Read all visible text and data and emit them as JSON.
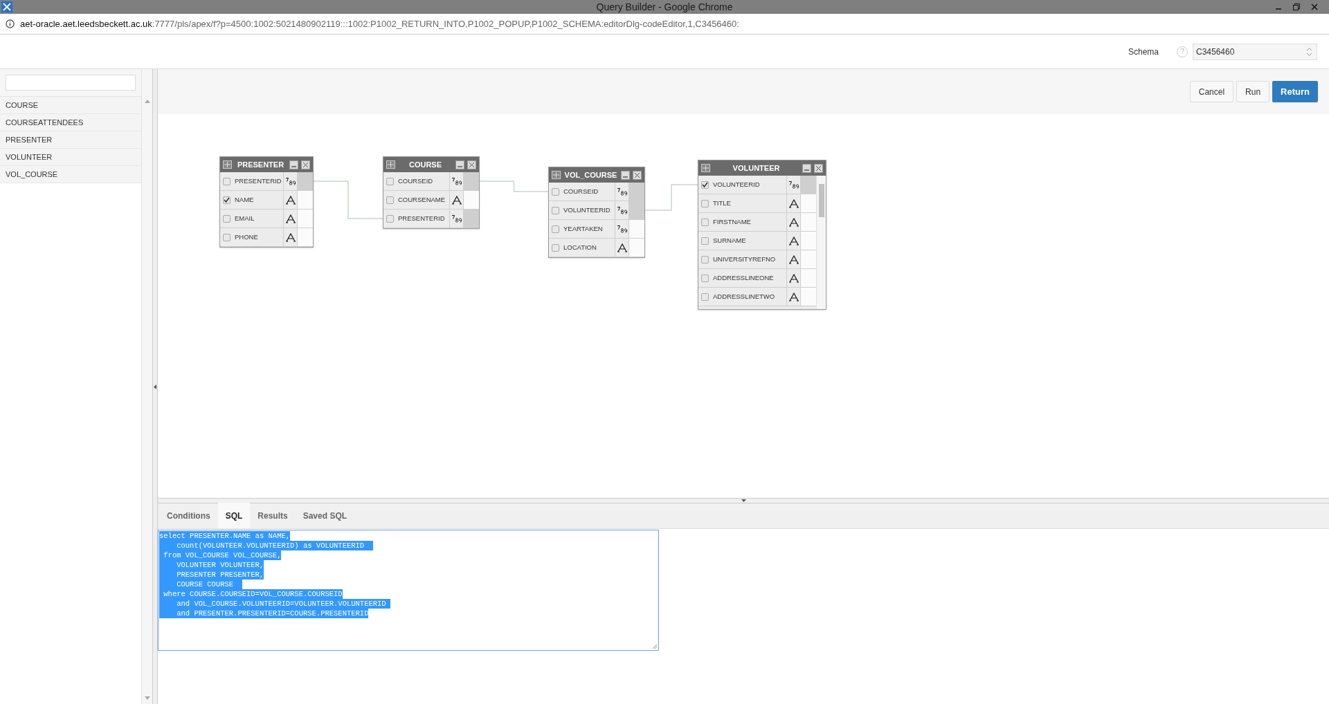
{
  "window": {
    "title": "Query Builder - Google Chrome"
  },
  "address_bar": {
    "host": "aet-oracle.aet.leedsbeckett.ac.uk",
    "path": ":7777/pls/apex/f?p=4500:1002:5021480902119:::1002:P1002_RETURN_INTO,P1002_POPUP,P1002_SCHEMA:editorDlg-codeEditor,1,C3456460:"
  },
  "schema": {
    "label": "Schema",
    "help": "?",
    "value": "C3456460"
  },
  "buttons": [
    {
      "label": "Cancel",
      "kind": "plain"
    },
    {
      "label": "Run",
      "kind": "plain"
    },
    {
      "label": "Return",
      "kind": "primary"
    }
  ],
  "sidebar": {
    "items": [
      {
        "label": "COURSE"
      },
      {
        "label": "COURSEATTENDEES"
      },
      {
        "label": "PRESENTER"
      },
      {
        "label": "VOLUNTEER"
      },
      {
        "label": "VOL_COURSE"
      }
    ]
  },
  "tables": [
    {
      "name": "PRESENTER",
      "columns": [
        {
          "name": "PRESENTERID",
          "kind": "number",
          "checked": false,
          "key": true
        },
        {
          "name": "NAME",
          "kind": "text",
          "checked": true,
          "key": false
        },
        {
          "name": "EMAIL",
          "kind": "text",
          "checked": false,
          "key": false
        },
        {
          "name": "PHONE",
          "kind": "text",
          "checked": false,
          "key": false
        }
      ]
    },
    {
      "name": "COURSE",
      "columns": [
        {
          "name": "COURSEID",
          "kind": "number",
          "checked": false,
          "key": true
        },
        {
          "name": "COURSENAME",
          "kind": "text",
          "checked": false,
          "key": false
        },
        {
          "name": "PRESENTERID",
          "kind": "number",
          "checked": false,
          "key": true
        }
      ]
    },
    {
      "name": "VOL_COURSE",
      "columns": [
        {
          "name": "COURSEID",
          "kind": "number",
          "checked": false,
          "key": true
        },
        {
          "name": "VOLUNTEERID",
          "kind": "number",
          "checked": false,
          "key": true
        },
        {
          "name": "YEARTAKEN",
          "kind": "number",
          "checked": false,
          "key": false
        },
        {
          "name": "LOCATION",
          "kind": "text",
          "checked": false,
          "key": false
        }
      ]
    },
    {
      "name": "VOLUNTEER",
      "columns": [
        {
          "name": "VOLUNTEERID",
          "kind": "number",
          "checked": true,
          "key": true
        },
        {
          "name": "TITLE",
          "kind": "text",
          "checked": false,
          "key": false
        },
        {
          "name": "FIRSTNAME",
          "kind": "text",
          "checked": false,
          "key": false
        },
        {
          "name": "SURNAME",
          "kind": "text",
          "checked": false,
          "key": false
        },
        {
          "name": "UNIVERSITYREFNO",
          "kind": "text",
          "checked": false,
          "key": false
        },
        {
          "name": "ADDRESSLINEONE",
          "kind": "text",
          "checked": false,
          "key": false
        },
        {
          "name": "ADDRESSLINETWO",
          "kind": "text",
          "checked": false,
          "key": false
        }
      ]
    }
  ],
  "tabs": [
    {
      "label": "Conditions",
      "selected": false
    },
    {
      "label": "SQL",
      "selected": true
    },
    {
      "label": "Results",
      "selected": false
    },
    {
      "label": "Saved SQL",
      "selected": false
    }
  ],
  "sql": [
    "select PRESENTER.NAME as NAME,",
    "    count(VOLUNTEER.VOLUNTEERID) as VOLUNTEERID  ",
    " from VOL_COURSE VOL_COURSE,",
    "    VOLUNTEER VOLUNTEER,",
    "    PRESENTER PRESENTER,",
    "    COURSE COURSE  ",
    " where COURSE.COURSEID=VOL_COURSE.COURSEID",
    "    and VOL_COURSE.VOLUNTEERID=VOLUNTEER.VOLUNTEERID ",
    "    and PRESENTER.PRESENTERID=COURSE.PRESENTERID"
  ]
}
